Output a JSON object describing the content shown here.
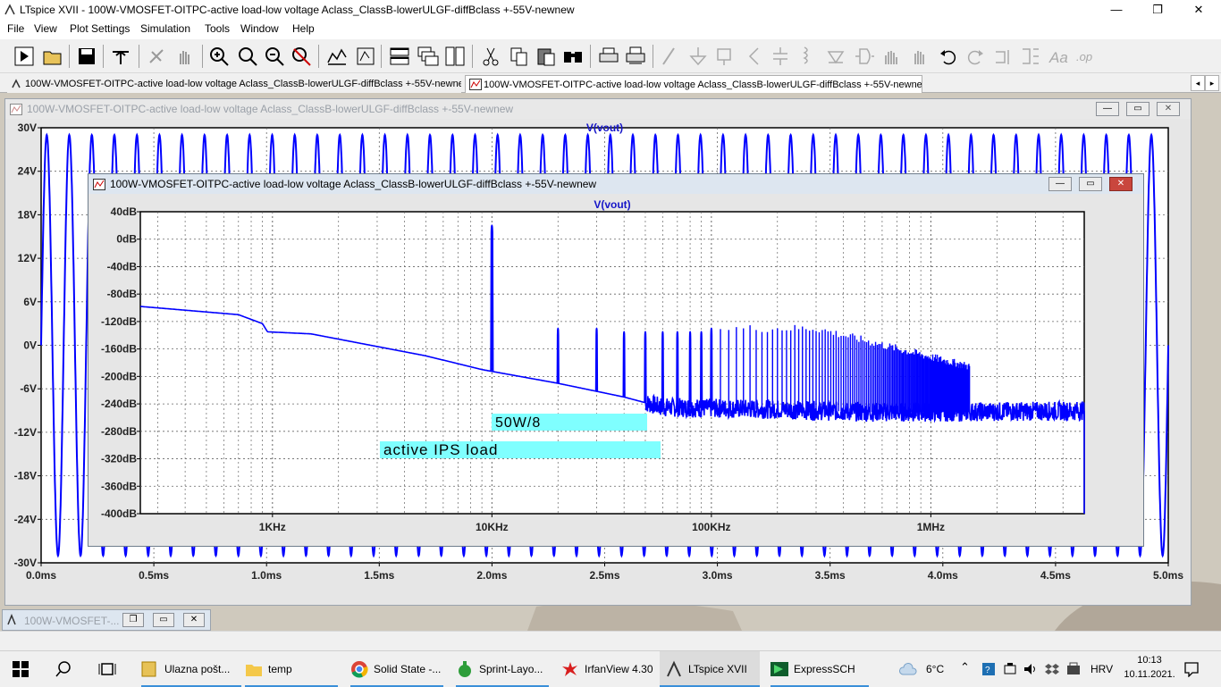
{
  "app": {
    "window_title": "LTspice XVII - 100W-VMOSFET-OITPC-active load-low voltage Aclass_ClassB-lowerULGF-diffBclass +-55V-newnew",
    "controls": {
      "minimize": "—",
      "maximize": "❐",
      "close": "✕"
    }
  },
  "menu": {
    "items": [
      {
        "label": "File"
      },
      {
        "label": "View"
      },
      {
        "label": "Plot Settings"
      },
      {
        "label": "Simulation"
      },
      {
        "label": "Tools"
      },
      {
        "label": "Window"
      },
      {
        "label": "Help"
      }
    ]
  },
  "toolbar": {
    "icons": [
      "run-icon",
      "open-icon",
      "save-icon",
      "control-panel-icon",
      "halt-icon",
      "pan-icon",
      "zoom-in-icon",
      "zoom-box-icon",
      "zoom-out-icon",
      "zoom-cancel-icon",
      "autorange-icon",
      "fit-icon",
      "tile-horizontal-icon",
      "cascade-icon",
      "tile-vertical-icon",
      "cut-icon",
      "copy-icon",
      "paste-icon",
      "find-icon",
      "print-icon",
      "print-preview-icon",
      "wire-icon",
      "ground-icon",
      "label-icon",
      "resistor-icon",
      "capacitor-icon",
      "inductor-icon",
      "diode-icon",
      "component-icon",
      "move-icon",
      "drag-icon",
      "undo-icon",
      "redo-icon",
      "rotate-icon",
      "mirror-icon",
      "text-icon",
      "spice-directive-icon"
    ]
  },
  "tabs": [
    {
      "label": "100W-VMOSFET-OITPC-active load-low voltage Aclass_ClassB-lowerULGF-diffBclass +-55V-newnew",
      "icon": "schematic-icon"
    },
    {
      "label": "100W-VMOSFET-OITPC-active load-low voltage Aclass_ClassB-lowerULGF-diffBclass +-55V-newnew",
      "icon": "waveform-icon"
    }
  ],
  "time_window": {
    "title": "100W-VMOSFET-OITPC-active load-low voltage Aclass_ClassB-lowerULGF-diffBclass +-55V-newnew",
    "trace_label": "V(vout)"
  },
  "fft_window": {
    "title": "100W-VMOSFET-OITPC-active load-low voltage Aclass_ClassB-lowerULGF-diffBclass +-55V-newnew",
    "trace_label": "V(vout)",
    "annotations": [
      "50W/8",
      "active IPS load"
    ]
  },
  "minimized_window": {
    "title": "100W-VMOSFET-..."
  },
  "chart_data": [
    {
      "type": "line",
      "title": "V(vout)",
      "xlabel": "",
      "ylabel": "",
      "x_unit": "ms",
      "y_unit": "V",
      "xlim": [
        0,
        5
      ],
      "ylim": [
        -30,
        30
      ],
      "x_ticks": [
        "0.0ms",
        "0.5ms",
        "1.0ms",
        "1.5ms",
        "2.0ms",
        "2.5ms",
        "3.0ms",
        "3.5ms",
        "4.0ms",
        "4.5ms",
        "5.0ms"
      ],
      "y_ticks": [
        "30V",
        "24V",
        "18V",
        "12V",
        "6V",
        "0V",
        "-6V",
        "-12V",
        "-18V",
        "-24V",
        "-30V"
      ],
      "grid": true,
      "series": [
        {
          "name": "V(vout)",
          "color": "#0000ff",
          "waveform": "sine",
          "frequency_khz": 10,
          "amplitude_v": 29,
          "offset_v": 0
        }
      ]
    },
    {
      "type": "line",
      "title": "V(vout)",
      "xlabel": "",
      "ylabel": "",
      "x_scale": "log",
      "x_unit": "Hz",
      "y_unit": "dB",
      "xlim": [
        250,
        5000000
      ],
      "ylim": [
        -400,
        40
      ],
      "x_ticks": [
        "1KHz",
        "10KHz",
        "100KHz",
        "1MHz"
      ],
      "y_ticks": [
        "40dB",
        "0dB",
        "-40dB",
        "-80dB",
        "-120dB",
        "-160dB",
        "-200dB",
        "-240dB",
        "-280dB",
        "-320dB",
        "-360dB",
        "-400dB"
      ],
      "grid": true,
      "series": [
        {
          "name": "V(vout)",
          "color": "#0000ff",
          "floor_points": [
            [
              250,
              -98
            ],
            [
              700,
              -110
            ],
            [
              900,
              -123
            ],
            [
              950,
              -135
            ],
            [
              1500,
              -138
            ],
            [
              5000,
              -170
            ],
            [
              9000,
              -190
            ],
            [
              20000,
              -210
            ],
            [
              40000,
              -230
            ],
            [
              60000,
              -245
            ],
            [
              200000,
              -248
            ],
            [
              500000,
              -252
            ],
            [
              1000000,
              -252
            ],
            [
              5000000,
              -250
            ]
          ],
          "peaks": [
            {
              "f": 10000,
              "db": 25
            },
            {
              "f": 20000,
              "db": -125
            },
            {
              "f": 30000,
              "db": -125
            },
            {
              "f": 40000,
              "db": -130
            },
            {
              "f": 50000,
              "db": -130
            },
            {
              "f": 60000,
              "db": -130
            },
            {
              "f": 70000,
              "db": -130
            },
            {
              "f": 80000,
              "db": -130
            },
            {
              "f": 90000,
              "db": -130
            },
            {
              "f": 100000,
              "db": -125
            }
          ]
        }
      ]
    }
  ],
  "taskbar": {
    "items": [
      {
        "label": "Ulazna pošt...",
        "icon": "mail-icon"
      },
      {
        "label": "temp",
        "icon": "folder-icon"
      },
      {
        "label": "Solid State -...",
        "icon": "chrome-icon"
      },
      {
        "label": "Sprint-Layo...",
        "icon": "sprint-layout-icon"
      },
      {
        "label": "IrfanView 4.30",
        "icon": "irfanview-icon"
      },
      {
        "label": "LTspice XVII",
        "icon": "ltspice-icon"
      },
      {
        "label": "ExpressSCH",
        "icon": "expresssch-icon"
      }
    ],
    "weather": "6°C",
    "language": "HRV",
    "time": "10:13",
    "date": "10.11.2021."
  }
}
